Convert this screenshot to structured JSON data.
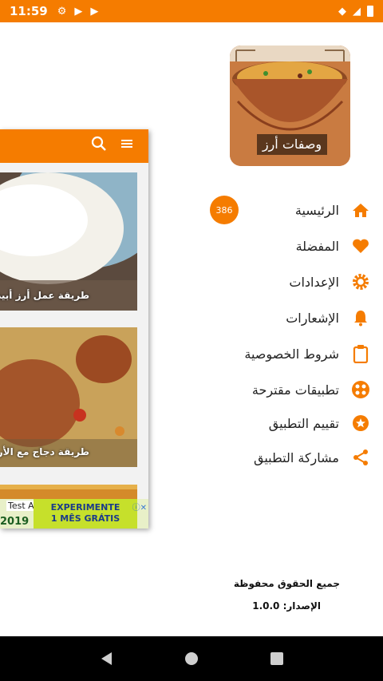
{
  "status_bar": {
    "time": "11:59",
    "left_icons": [
      "gear-icon",
      "play-store-icon",
      "play-store-icon"
    ],
    "right_icons": [
      "signal-icon",
      "wifi-icon",
      "battery-icon"
    ],
    "color": "#f57c00"
  },
  "background_screen": {
    "toolbar_icons": [
      "search-icon",
      "menu-icon"
    ],
    "cards": [
      {
        "title": "طريقة عمل أرز أبيض"
      },
      {
        "title": "طريقة دجاج مع الأرز"
      },
      {
        "title": ""
      }
    ],
    "ad": {
      "label": "Test Ad",
      "year": "2019",
      "cta_line1": "EXPERIMENTE",
      "cta_line2": "1 MÊS GRÁTIS"
    }
  },
  "drawer": {
    "logo_caption": "وصفات أرز",
    "badge": "386",
    "items": [
      {
        "label": "الرئيسية",
        "icon": "home-icon"
      },
      {
        "label": "المفضلة",
        "icon": "heart-icon"
      },
      {
        "label": "الإعدادات",
        "icon": "gear-icon"
      },
      {
        "label": "الإشعارات",
        "icon": "bell-icon"
      },
      {
        "label": "شروط الخصوصية",
        "icon": "clipboard-icon"
      },
      {
        "label": "تطبيقات مقترحة",
        "icon": "apps-icon"
      },
      {
        "label": "تقييم التطبيق",
        "icon": "star-icon"
      },
      {
        "label": "مشاركة التطبيق",
        "icon": "share-icon"
      }
    ],
    "footer": {
      "rights": "جميع الحقوق محفوظة",
      "version_label": "الإصدار:",
      "version": "1.0.0"
    }
  },
  "nav_bar": {
    "buttons": [
      "back-icon",
      "home-circle-icon",
      "recents-icon"
    ]
  },
  "colors": {
    "accent": "#f57c00",
    "text": "#222222"
  }
}
